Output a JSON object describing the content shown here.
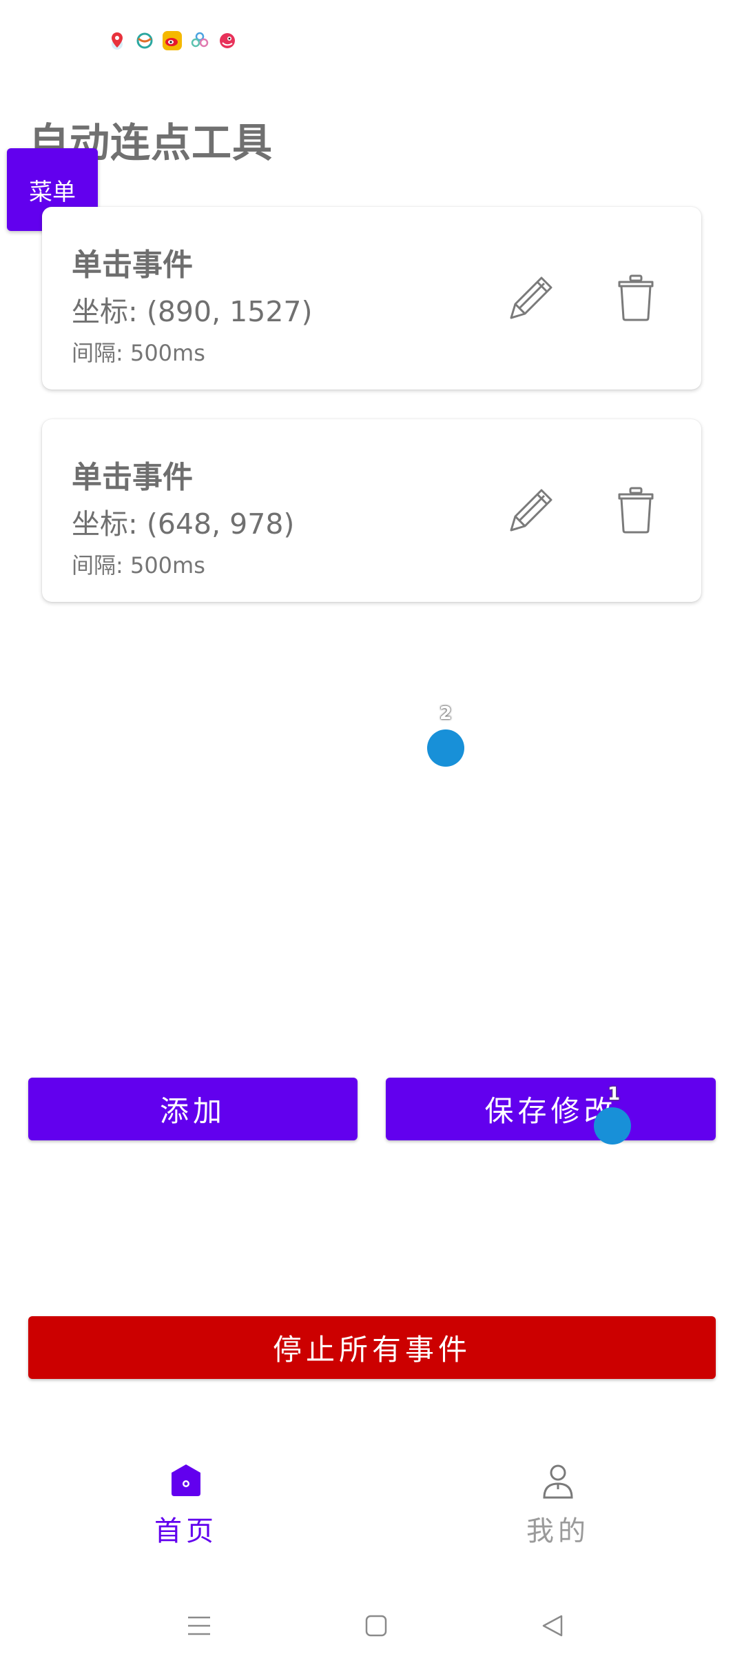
{
  "status_bar": {
    "icons": [
      "map-pin-icon",
      "globe-app-icon",
      "weibo-icon",
      "clover-app-icon",
      "bird-app-icon"
    ]
  },
  "header": {
    "title": "自动连点工具"
  },
  "menu_button": {
    "label": "菜单"
  },
  "events": [
    {
      "title": "单击事件",
      "coordinate": "坐标: (890, 1527)",
      "interval": "间隔: 500ms"
    },
    {
      "title": "单击事件",
      "coordinate": "坐标: (648, 978)",
      "interval": "间隔: 500ms"
    }
  ],
  "markers": [
    {
      "label": "2"
    },
    {
      "label": "1"
    }
  ],
  "actions": {
    "add_label": "添加",
    "save_label": "保存修改",
    "stop_all_label": "停止所有事件"
  },
  "bottom_nav": {
    "items": [
      {
        "label": "首页",
        "icon": "home-icon",
        "active": true
      },
      {
        "label": "我的",
        "icon": "person-icon",
        "active": false
      }
    ]
  },
  "colors": {
    "primary": "#6200ee",
    "danger": "#cc0000",
    "marker": "#1890d8"
  }
}
